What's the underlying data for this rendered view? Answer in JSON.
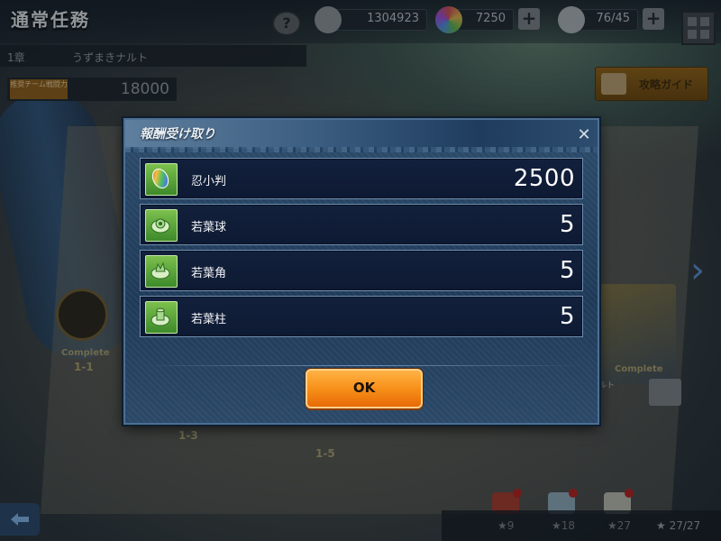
{
  "screen": {
    "title": "通常任務",
    "help_label": "?"
  },
  "resources": [
    {
      "icon": "shuriken-coin-icon",
      "value": "1304923"
    },
    {
      "icon": "ninja-koban-icon",
      "value": "7250"
    },
    {
      "icon": "stamina-riceball-icon",
      "value": "76/45"
    }
  ],
  "chapter": {
    "number": "1章",
    "name": "うずまきナルト"
  },
  "power": {
    "label": "推奨チーム戦闘力",
    "value": "18000"
  },
  "guide_button": {
    "label": "攻略ガイド"
  },
  "stages": [
    "1-1",
    "1-3",
    "1-5"
  ],
  "stage_status": "Complete",
  "stage_name_fragment": "ルト",
  "stars": [
    "★9",
    "★18",
    "★27",
    "★ 27/27"
  ],
  "modal": {
    "title": "報酬受け取り",
    "close_label": "✕",
    "rewards": [
      {
        "name": "忍小判",
        "qty": "2500",
        "icon": "ninja-koban-icon"
      },
      {
        "name": "若葉球",
        "qty": "5",
        "icon": "wakaba-sphere-icon"
      },
      {
        "name": "若葉角",
        "qty": "5",
        "icon": "wakaba-horn-icon"
      },
      {
        "name": "若葉柱",
        "qty": "5",
        "icon": "wakaba-pillar-icon"
      }
    ],
    "ok_label": "OK"
  },
  "colors": {
    "modal_bg": "#1e3a58",
    "row_bg": "#12203c",
    "ok_button": "#f7901a",
    "item_icon_green": "#5aa83a"
  }
}
